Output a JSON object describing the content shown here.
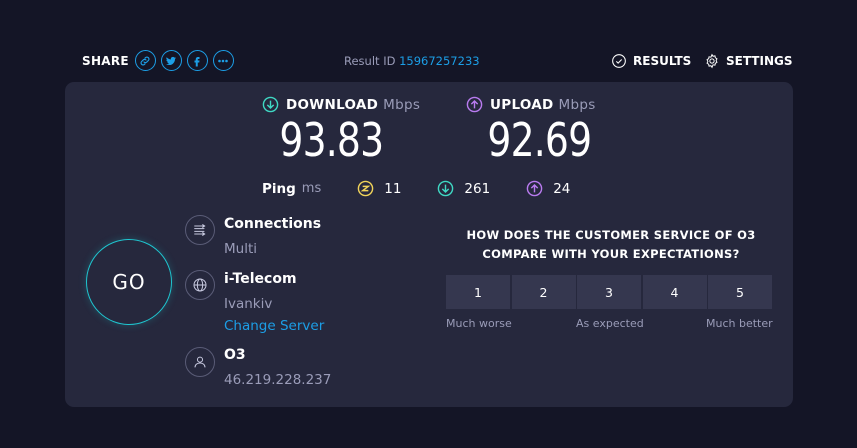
{
  "header": {
    "share_label": "SHARE",
    "share_icons": [
      "link-icon",
      "twitter-icon",
      "facebook-icon",
      "more-icon"
    ],
    "result_id_label": "Result ID",
    "result_id": "15967257233",
    "results_label": "RESULTS",
    "settings_label": "SETTINGS"
  },
  "download": {
    "label": "DOWNLOAD",
    "unit": "Mbps",
    "value": "93.83",
    "color": "#3fd9c4"
  },
  "upload": {
    "label": "UPLOAD",
    "unit": "Mbps",
    "value": "92.69",
    "color": "#b97bf0"
  },
  "ping": {
    "label": "Ping",
    "unit": "ms",
    "jitter": "11",
    "download_latency": "261",
    "upload_latency": "24",
    "jitter_color": "#f1d45a"
  },
  "go_label": "GO",
  "connections": {
    "title": "Connections",
    "value": "Multi"
  },
  "server": {
    "title": "i-Telecom",
    "location": "Ivankiv",
    "change_label": "Change Server"
  },
  "isp": {
    "title": "O3",
    "ip": "46.219.228.237"
  },
  "survey": {
    "question_line1": "HOW DOES THE CUSTOMER SERVICE OF O3",
    "question_line2": "COMPARE WITH YOUR EXPECTATIONS?",
    "options": [
      "1",
      "2",
      "3",
      "4",
      "5"
    ],
    "low_label": "Much worse",
    "mid_label": "As expected",
    "high_label": "Much better"
  },
  "colors": {
    "accent": "#1c9ee6",
    "background": "#141526",
    "panel": "#26283d",
    "go_ring": "#1fc6d0"
  }
}
